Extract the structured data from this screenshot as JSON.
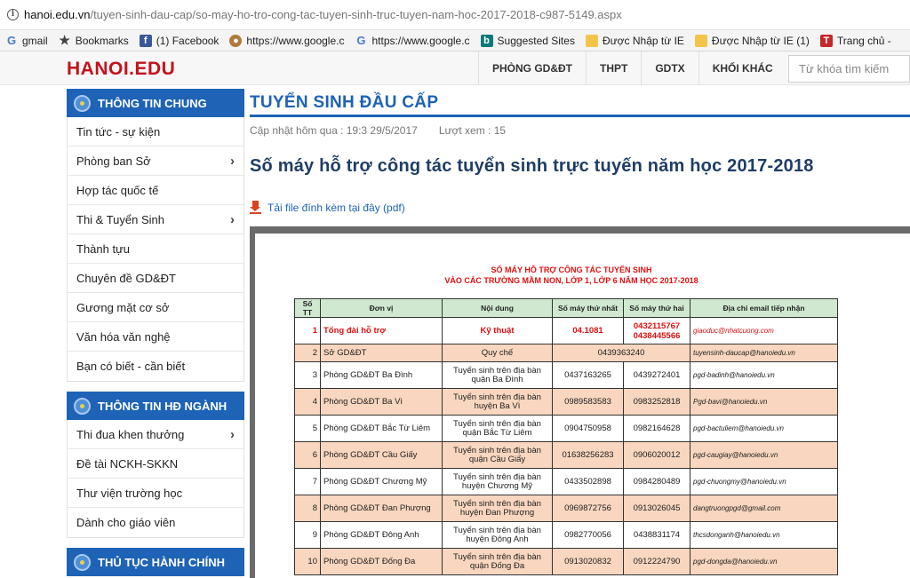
{
  "browser": {
    "url_host": "hanoi.edu.vn",
    "url_path": "/tuyen-sinh-dau-cap/so-may-ho-tro-cong-tac-tuyen-sinh-truc-tuyen-nam-hoc-2017-2018-c987-5149.aspx",
    "bookmarks": [
      {
        "label": "gmail",
        "icon": "google-icon"
      },
      {
        "label": "Bookmarks",
        "icon": "star-icon"
      },
      {
        "label": "(1) Facebook",
        "icon": "facebook-icon"
      },
      {
        "label": "https://www.google.c",
        "icon": "cookie-icon"
      },
      {
        "label": "https://www.google.c",
        "icon": "google-icon"
      },
      {
        "label": "Suggested Sites",
        "icon": "bing-icon"
      },
      {
        "label": "Được Nhập từ IE",
        "icon": "folder-icon"
      },
      {
        "label": "Được Nhập từ IE (1)",
        "icon": "folder-icon"
      },
      {
        "label": "Trang chủ -",
        "icon": "tr-icon"
      }
    ]
  },
  "site": {
    "logo": "HANOI.EDU",
    "nav": [
      "PHÒNG GD&ĐT",
      "THPT",
      "GDTX",
      "KHỐI KHÁC"
    ],
    "search_placeholder": "Từ khóa tìm kiếm"
  },
  "sidebar": {
    "sections": [
      {
        "title": "THÔNG TIN CHUNG",
        "items": [
          {
            "label": "Tin tức - sự kiện",
            "chevron": false
          },
          {
            "label": "Phòng ban Sở",
            "chevron": true
          },
          {
            "label": "Hợp tác quốc tế",
            "chevron": false
          },
          {
            "label": "Thi & Tuyển Sinh",
            "chevron": true
          },
          {
            "label": "Thành tựu",
            "chevron": false
          },
          {
            "label": "Chuyên đề GD&ĐT",
            "chevron": false
          },
          {
            "label": "Gương mặt cơ sở",
            "chevron": false
          },
          {
            "label": "Văn hóa văn nghệ",
            "chevron": false
          },
          {
            "label": "Bạn có biết - cần biết",
            "chevron": false
          }
        ]
      },
      {
        "title": "THÔNG TIN HĐ NGÀNH",
        "items": [
          {
            "label": "Thi đua khen thưởng",
            "chevron": true
          },
          {
            "label": "Đề tài NCKH-SKKN",
            "chevron": false
          },
          {
            "label": "Thư viện trường học",
            "chevron": false
          },
          {
            "label": "Dành cho giáo viên",
            "chevron": false
          }
        ]
      },
      {
        "title": "THỦ TỤC HÀNH CHÍNH",
        "items": []
      }
    ]
  },
  "article": {
    "category": "TUYỂN SINH ĐẦU CẤP",
    "updated": "Cập nhật hôm qua : 19:3 29/5/2017",
    "views": "Lượt xem : 15",
    "title": "Số máy hỗ trợ công tác tuyển sinh trực tuyến năm học 2017-2018",
    "download": "Tải file đính kèm tại đây (pdf)"
  },
  "document": {
    "title_line1": "SỐ MÁY HỖ TRỢ CÔNG TÁC TUYỂN SINH",
    "title_line2": "VÀO CÁC TRƯỜNG MẦM NON, LỚP 1, LỚP 6 NĂM HỌC 2017-2018",
    "headers": [
      "Số TT",
      "Đơn vị",
      "Nội dung",
      "Số máy thứ nhất",
      "Số máy thứ hai",
      "Địa chỉ email tiếp nhận"
    ],
    "rows": [
      {
        "stt": "1",
        "unit": "Tổng đài hỗ trợ",
        "content": "Kỹ thuật",
        "phone1": "04.1081",
        "phone2": "0432115767",
        "phone2b": "0438445566",
        "email": "giaoduc@nhatcuong.com"
      },
      {
        "stt": "2",
        "unit": "Sở GD&ĐT",
        "content": "Quy chế",
        "phone_merged": "0439363240",
        "email": "tuyensinh-daucap@hanoiedu.vn"
      },
      {
        "stt": "3",
        "unit": "Phòng GD&ĐT Ba Đình",
        "content": "Tuyển sinh trên địa bàn quận Ba Đình",
        "phone1": "0437163265",
        "phone2": "0439272401",
        "email": "pgd-badinh@hanoiedu.vn"
      },
      {
        "stt": "4",
        "unit": "Phòng GD&ĐT Ba Vì",
        "content": "Tuyển sinh trên địa bàn huyện Ba Vì",
        "phone1": "0989583583",
        "phone2": "0983252818",
        "email": "Pgd-bavi@hanoiedu.vn"
      },
      {
        "stt": "5",
        "unit": "Phòng GD&ĐT Bắc Từ Liêm",
        "content": "Tuyển sinh trên địa bàn quận Bắc Từ Liêm",
        "phone1": "0904750958",
        "phone2": "0982164628",
        "email": "pgd-bactuliem@hanoiedu.vn"
      },
      {
        "stt": "6",
        "unit": "Phòng GD&ĐT Cầu Giấy",
        "content": "Tuyển sinh trên địa bàn quận Cầu Giấy",
        "phone1": "01638256283",
        "phone2": "0906020012",
        "email": "pgd-caugiay@hanoiedu.vn"
      },
      {
        "stt": "7",
        "unit": "Phòng GD&ĐT Chương Mỹ",
        "content": "Tuyển sinh trên địa bàn huyện Chương Mỹ",
        "phone1": "0433502898",
        "phone2": "0984280489",
        "email": "pgd-chuongmy@hanoiedu.vn"
      },
      {
        "stt": "8",
        "unit": "Phòng GD&ĐT Đan Phượng",
        "content": "Tuyển sinh trên địa bàn huyện Đan Phượng",
        "phone1": "0969872756",
        "phone2": "0913026045",
        "email": "dangtruongpgd@gmail.com"
      },
      {
        "stt": "9",
        "unit": "Phòng GD&ĐT Đông Anh",
        "content": "Tuyển sinh trên địa bàn huyện Đông Anh",
        "phone1": "0982770056",
        "phone2": "0438831174",
        "email": "thcsdonganh@hanoiedu.vn"
      },
      {
        "stt": "10",
        "unit": "Phòng GD&ĐT Đống Đa",
        "content": "Tuyển sinh trên địa bàn quận Đống Đa",
        "phone1": "0913020832",
        "phone2": "0912224790",
        "email": "pgd-dongda@hanoiedu.vn"
      }
    ]
  }
}
